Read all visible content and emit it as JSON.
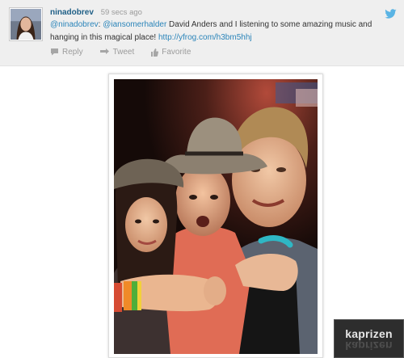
{
  "tweet": {
    "username": "ninadobrev",
    "timestamp": "59 secs ago",
    "text_parts": {
      "mention1": "@ninadobrev",
      "colon": ": ",
      "mention2": "@iansomerhalder",
      "body": " David Anders and I listening to some amazing music and hanging in this magical place! ",
      "url": "http://yfrog.com/h3bm5hhj"
    },
    "actions": {
      "reply": "Reply",
      "retweet": "Tweet",
      "favorite": "Favorite"
    },
    "icons": {
      "service": "twitter-bird-icon",
      "reply": "reply-icon",
      "retweet": "retweet-icon",
      "favorite": "thumbs-up-icon"
    },
    "colors": {
      "username": "#1f5f86",
      "link": "#2a84b9",
      "card_bg": "#efefef",
      "action_text": "#9b9b9b"
    }
  },
  "watermark": {
    "text": "kaprizen"
  }
}
